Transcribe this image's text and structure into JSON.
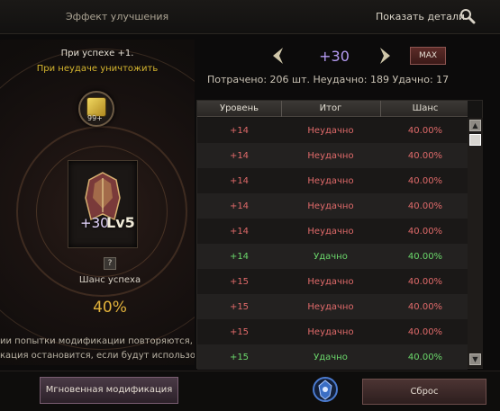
{
  "header": {
    "title": "Эффект улучшения",
    "details_label": "Показать детали",
    "search_icon": "magnifier-icon"
  },
  "left": {
    "success_text": "При успехе +1.",
    "fail_text": "При неудаче уничтожить",
    "scroll_count": "99+",
    "item_enchant": "+30",
    "item_level": "Lv5",
    "help_label": "?",
    "chance_label": "Шанс успеха",
    "chance_value": "40%",
    "note_line1": "ии попытки модификации повторяются, пок",
    "note_line2": "кация остановится, если будут использова"
  },
  "controls": {
    "target_level": "+30",
    "max_label": "MAX",
    "stats": "Потрачено: 206 шт.   Неудачно: 189   Удачно: 17"
  },
  "table": {
    "headers": [
      "Уровень",
      "Итог",
      "Шанс"
    ],
    "rows": [
      {
        "level": "+14",
        "result": "Неудачно",
        "chance": "40.00%",
        "status": "fail"
      },
      {
        "level": "+14",
        "result": "Неудачно",
        "chance": "40.00%",
        "status": "fail"
      },
      {
        "level": "+14",
        "result": "Неудачно",
        "chance": "40.00%",
        "status": "fail"
      },
      {
        "level": "+14",
        "result": "Неудачно",
        "chance": "40.00%",
        "status": "fail"
      },
      {
        "level": "+14",
        "result": "Неудачно",
        "chance": "40.00%",
        "status": "fail"
      },
      {
        "level": "+14",
        "result": "Удачно",
        "chance": "40.00%",
        "status": "success"
      },
      {
        "level": "+15",
        "result": "Неудачно",
        "chance": "40.00%",
        "status": "fail"
      },
      {
        "level": "+15",
        "result": "Неудачно",
        "chance": "40.00%",
        "status": "fail"
      },
      {
        "level": "+15",
        "result": "Неудачно",
        "chance": "40.00%",
        "status": "fail"
      },
      {
        "level": "+15",
        "result": "Удачно",
        "chance": "40.00%",
        "status": "success"
      }
    ]
  },
  "footer": {
    "instant_label": "Мгновенная модификация",
    "reset_label": "Сброс"
  },
  "colors": {
    "fail": "#e06a6a",
    "success": "#6bd86b",
    "target_level": "#b59bf2",
    "chance": "#e2b23b",
    "warning": "#d6b62f"
  }
}
